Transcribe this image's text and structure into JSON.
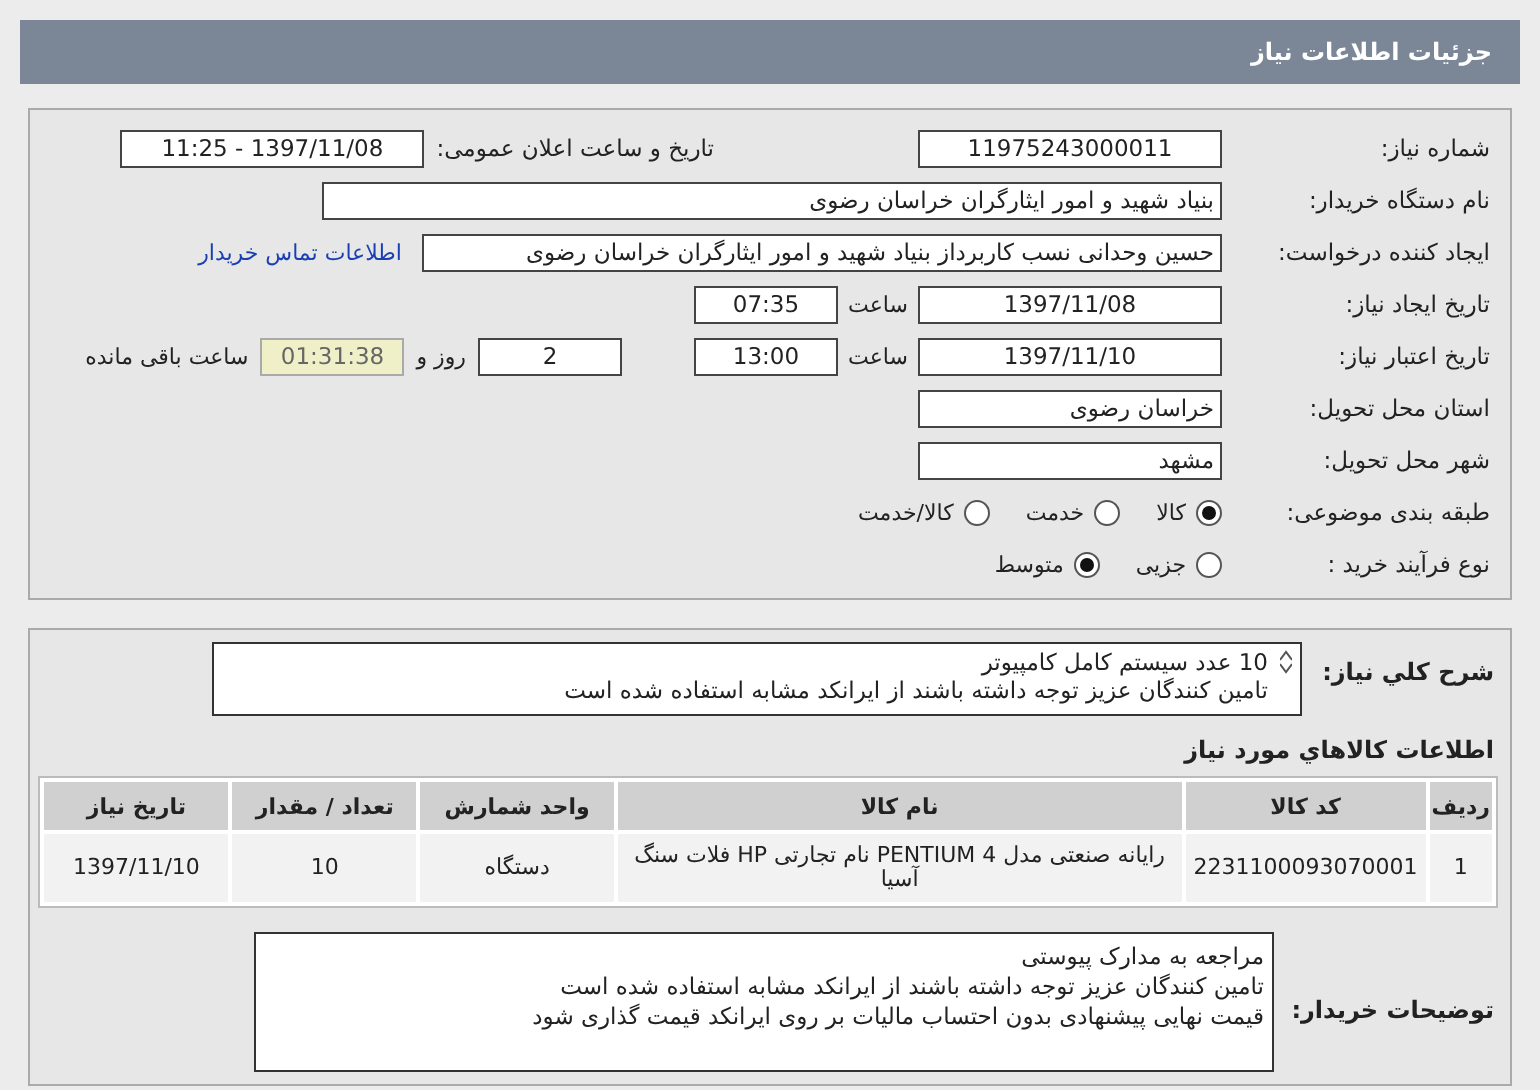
{
  "header": {
    "title": "جزئیات اطلاعات نیاز"
  },
  "fields": {
    "need_number": {
      "label": "شماره نیاز:",
      "value": "11975243000011"
    },
    "announce": {
      "label": "تاریخ و ساعت اعلان عمومی:",
      "value": "1397/11/08 - 11:25"
    },
    "buyer": {
      "label": "نام دستگاه خریدار:",
      "value": "بنیاد شهید و امور ایثارگران خراسان رضوی"
    },
    "requester": {
      "label": "ایجاد کننده درخواست:",
      "value": "حسین وحدانی نسب کاربرداز بنیاد شهید و امور ایثارگران خراسان رضوی",
      "link": "اطلاعات تماس خریدار"
    },
    "created": {
      "label": "تاریخ ایجاد نیاز:",
      "date": "1397/11/08",
      "time_label": "ساعت",
      "time": "07:35"
    },
    "deadline": {
      "label": "تاریخ اعتبار نیاز:",
      "date": "1397/11/10",
      "time_label": "ساعت",
      "time": "13:00",
      "days": "2",
      "days_label": "روز و",
      "remaining": "01:31:38",
      "remaining_label": "ساعت باقی مانده"
    },
    "province": {
      "label": "استان محل تحویل:",
      "value": "خراسان رضوی"
    },
    "city": {
      "label": "شهر محل تحویل:",
      "value": "مشهد"
    }
  },
  "category": {
    "label": "طبقه بندی موضوعی:",
    "options": [
      {
        "label": "کالا",
        "selected": true
      },
      {
        "label": "خدمت",
        "selected": false
      },
      {
        "label": "کالا/خدمت",
        "selected": false
      }
    ]
  },
  "process": {
    "label": "نوع فرآیند خرید :",
    "options": [
      {
        "label": "جزیی",
        "selected": false
      },
      {
        "label": "متوسط",
        "selected": true
      }
    ]
  },
  "summary": {
    "label": "شرح کلي نياز:",
    "lines": [
      "10 عدد سیستم کامل کامپیوتر",
      "تامین کنندگان عزیز توجه داشته باشند از ایرانکد مشابه استفاده شده است"
    ]
  },
  "goods": {
    "title": "اطلاعات کالاهاي مورد نياز",
    "columns": [
      "ردیف",
      "کد کالا",
      "نام کالا",
      "واحد شمارش",
      "تعداد / مقدار",
      "تاریخ نیاز"
    ],
    "rows": [
      [
        "1",
        "2231100093070001",
        "رایانه صنعتی مدل PENTIUM 4 نام تجارتی HP فلات سنگ آسیا",
        "دستگاه",
        "10",
        "1397/11/10"
      ]
    ]
  },
  "notes": {
    "label": "توضیحات خریدار:",
    "lines": [
      "مراجعه به مدارک پیوستی",
      "تامین کنندگان عزیز توجه داشته باشند از ایرانکد مشابه استفاده شده است",
      "قیمت نهایی پیشنهادی بدون احتساب مالیات بر روی ایرانکد قیمت گذاری شود"
    ]
  }
}
